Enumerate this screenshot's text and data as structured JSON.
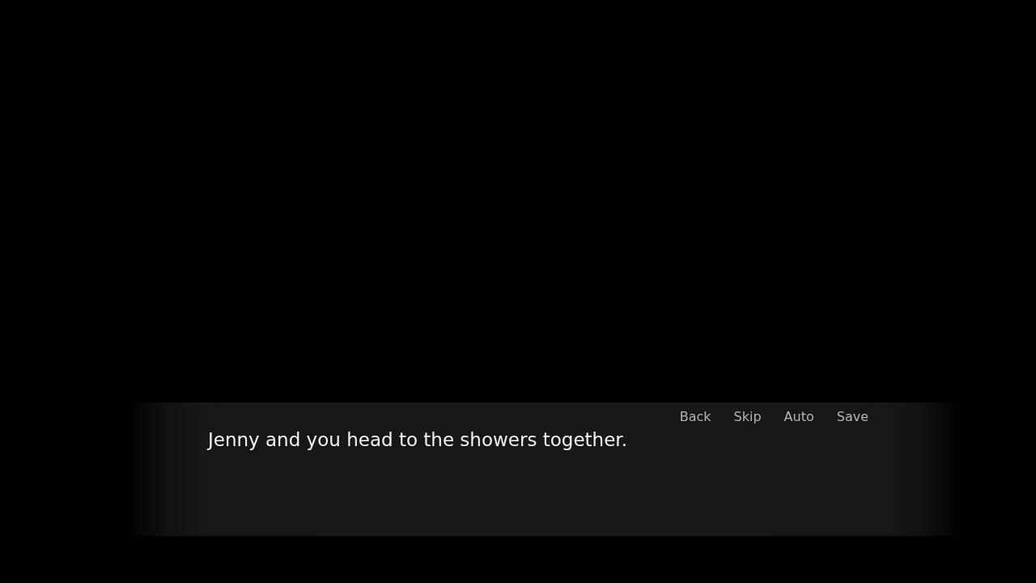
{
  "quick_menu": [
    {
      "label": "Back"
    },
    {
      "label": "Skip"
    },
    {
      "label": "Auto"
    },
    {
      "label": "Save"
    }
  ],
  "dialogue": {
    "text": "Jenny and you head to the showers together."
  }
}
